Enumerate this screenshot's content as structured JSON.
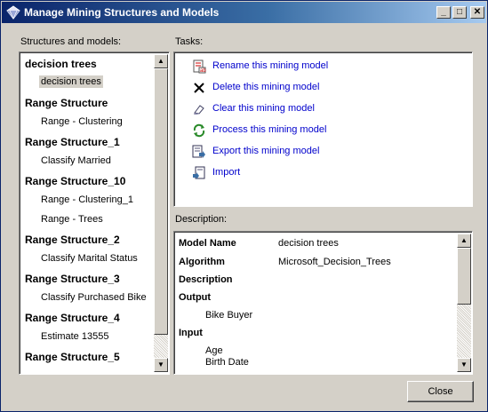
{
  "window": {
    "title": "Manage Mining Structures and Models",
    "minimize": "_",
    "maximize": "□",
    "close": "✕"
  },
  "structures": {
    "label": "Structures and models:",
    "items": [
      {
        "type": "structure",
        "label": "decision trees"
      },
      {
        "type": "model",
        "label": "decision trees",
        "selected": true
      },
      {
        "type": "structure",
        "label": "Range Structure"
      },
      {
        "type": "model",
        "label": "Range - Clustering"
      },
      {
        "type": "structure",
        "label": "Range Structure_1"
      },
      {
        "type": "model",
        "label": "Classify Married"
      },
      {
        "type": "structure",
        "label": "Range Structure_10"
      },
      {
        "type": "model",
        "label": "Range - Clustering_1"
      },
      {
        "type": "model",
        "label": "Range - Trees"
      },
      {
        "type": "structure",
        "label": "Range Structure_2"
      },
      {
        "type": "model",
        "label": "Classify Marital Status"
      },
      {
        "type": "structure",
        "label": "Range Structure_3"
      },
      {
        "type": "model",
        "label": "Classify Purchased Bike"
      },
      {
        "type": "structure",
        "label": "Range Structure_4"
      },
      {
        "type": "model",
        "label": "Estimate 13555"
      },
      {
        "type": "structure",
        "label": "Range Structure_5"
      }
    ]
  },
  "tasks": {
    "label": "Tasks:",
    "items": [
      {
        "label": "Rename this mining model",
        "icon": "rename-icon"
      },
      {
        "label": "Delete this mining model",
        "icon": "delete-icon"
      },
      {
        "label": "Clear this mining model",
        "icon": "clear-icon"
      },
      {
        "label": "Process this mining model",
        "icon": "process-icon"
      },
      {
        "label": "Export this mining model",
        "icon": "export-icon"
      },
      {
        "label": "Import",
        "icon": "import-icon"
      }
    ]
  },
  "description": {
    "label": "Description:",
    "model_name_key": "Model Name",
    "model_name_value": "decision trees",
    "algorithm_key": "Algorithm",
    "algorithm_value": "Microsoft_Decision_Trees",
    "description_key": "Description",
    "output_key": "Output",
    "output_values": [
      "Bike Buyer"
    ],
    "input_key": "Input",
    "input_values": [
      "Age",
      "Birth Date"
    ]
  },
  "buttons": {
    "close": "Close"
  },
  "colors": {
    "title_start": "#0a246a",
    "title_end": "#a6caf0",
    "link": "#0000cc",
    "face": "#d4d0c8"
  }
}
